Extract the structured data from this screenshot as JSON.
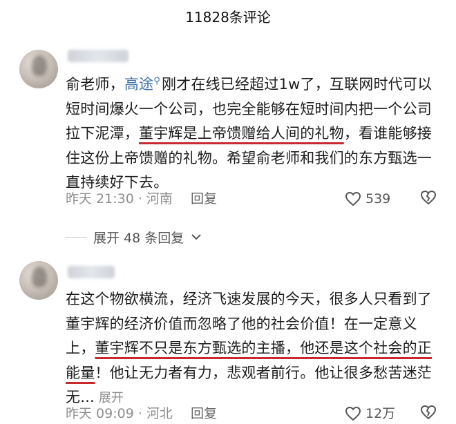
{
  "header": {
    "title": "11828条评论"
  },
  "comments": [
    {
      "text_a": "俞老师，",
      "mention": "高途",
      "text_b": "刚才在线已经超过1w了，互联网时代可以短时间爆火一个公司，也完全能够在短时间内把一个公司拉下泥潭，",
      "highlight": "董宇辉是上帝馈赠给人间的礼物",
      "text_c": "，看谁能够接住这份上帝馈赠的礼物。希望俞老师和我们的东方甄选一直持续好下去。",
      "time_location": "昨天 21:30 · 河南",
      "reply_label": "回复",
      "likes": "539"
    },
    {
      "text_a": "在这个物欲横流，经济飞速发展的今天，很多人只看到了董宇辉的经济价值而忽略了他的社会价值！在一定意义上，",
      "highlight": "董宇辉不只是东方甄选的主播，他还是这个社会的正能量",
      "text_c": "！他让无力者有力，悲观者前行。他让很多愁苦迷茫无...",
      "expand_label": "展开",
      "time_location": "昨天 09:09 · 河北",
      "reply_label": "回复",
      "likes": "12万"
    }
  ],
  "expand_replies": {
    "label": "展开 48 条回复"
  },
  "colors": {
    "mention": "#3d6fa6",
    "underline": "#c8282e",
    "meta": "#8e8e8e"
  }
}
